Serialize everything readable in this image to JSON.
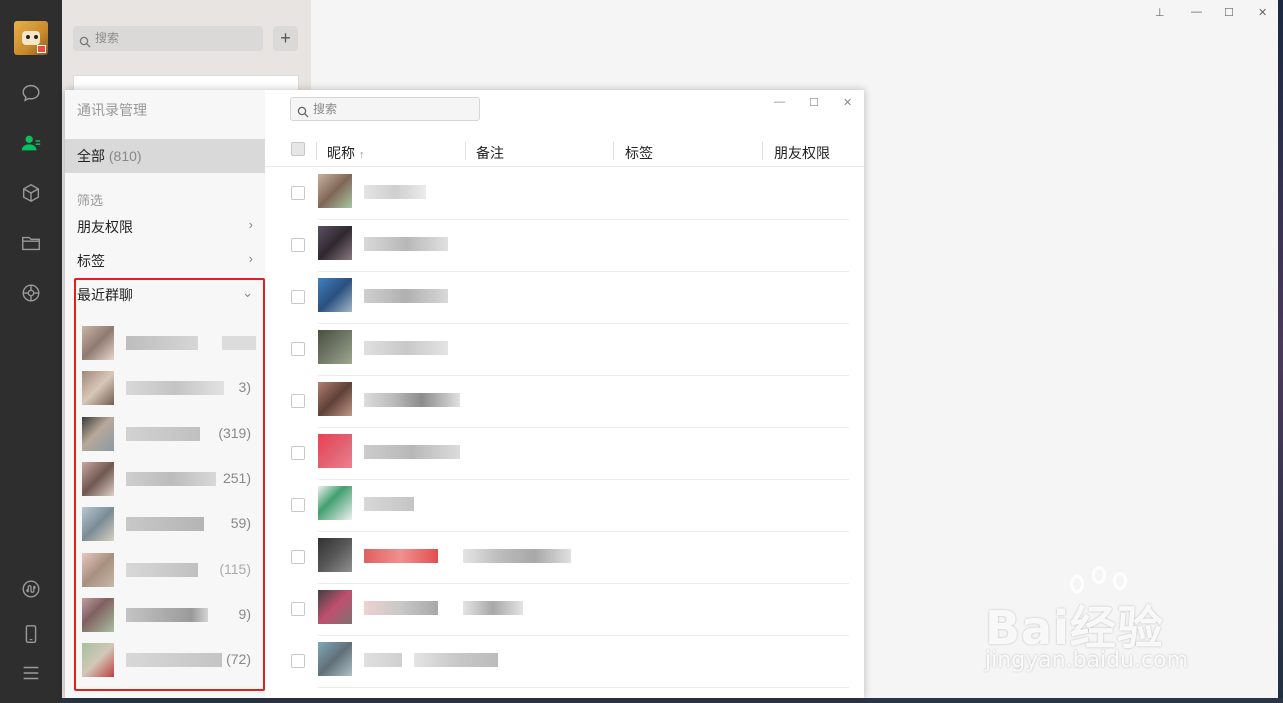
{
  "sidebar": {
    "icons": [
      "chat-icon",
      "contacts-icon",
      "favorites-icon",
      "files-icon",
      "moments-icon",
      "miniprogram-icon",
      "phone-icon",
      "menu-icon"
    ]
  },
  "chat_list": {
    "search_placeholder": "搜索",
    "add_label": "+"
  },
  "window_controls": {
    "pin": "⊥",
    "minimize": "—",
    "maximize": "☐",
    "close": "✕"
  },
  "manager": {
    "title": "通讯录管理",
    "all_label": "全部",
    "all_count": "(810)",
    "filter_label": "筛选",
    "filters": [
      {
        "label": "朋友权限",
        "chevron": "›"
      },
      {
        "label": "标签",
        "chevron": "›"
      }
    ],
    "recent_groups_label": "最近群聊",
    "recent_groups_chevron": "⌄",
    "groups": [
      {
        "count": ""
      },
      {
        "count": "3)"
      },
      {
        "count": "(319)"
      },
      {
        "count": "251)"
      },
      {
        "count": "59)"
      },
      {
        "count": "(115)"
      },
      {
        "count": "9)"
      },
      {
        "count": "(72)"
      }
    ],
    "search_placeholder": "搜索",
    "columns": {
      "nickname": "昵称",
      "sort_arrow": "↑",
      "remark": "备注",
      "tags": "标签",
      "permission": "朋友权限"
    }
  },
  "watermark": {
    "brand": "Bai经验",
    "url": "jingyan.baidu.com"
  }
}
